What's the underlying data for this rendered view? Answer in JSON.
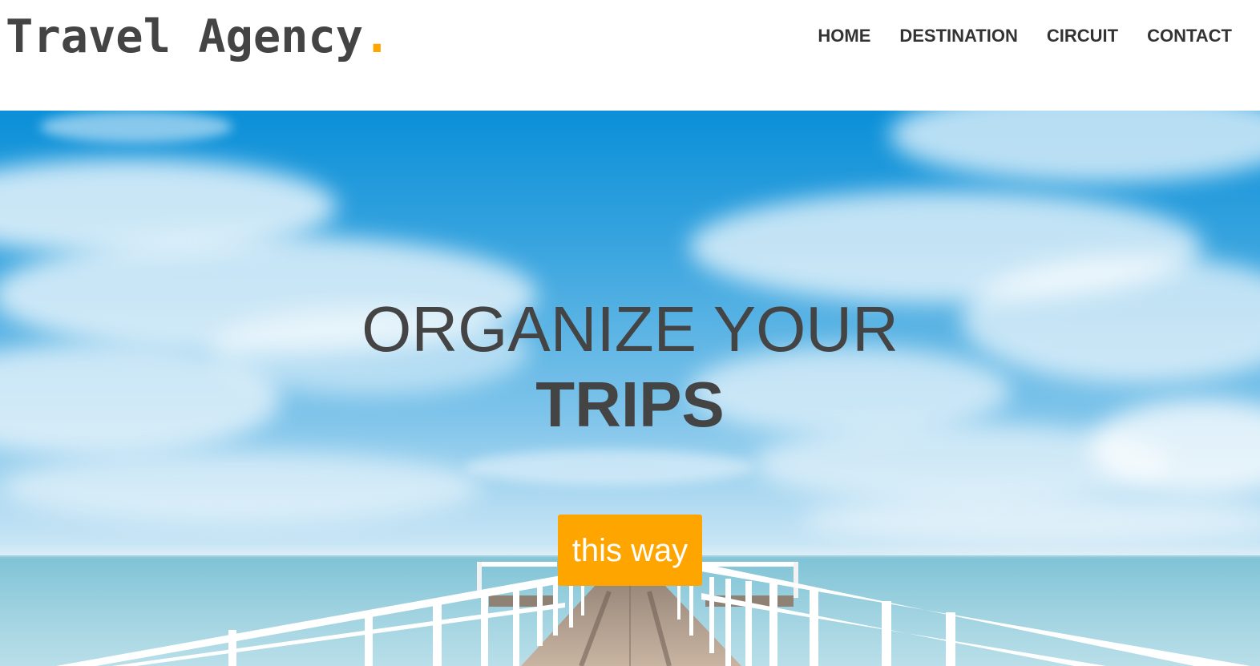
{
  "brand": {
    "name": "Travel Agency",
    "dot": ".",
    "accent_color": "#ffa500",
    "text_color": "#444444"
  },
  "nav": {
    "items": [
      {
        "label": "HOME"
      },
      {
        "label": "DESTINATION"
      },
      {
        "label": "CIRCUIT"
      },
      {
        "label": "CONTACT"
      }
    ]
  },
  "hero": {
    "headline_line1": "ORGANIZE YOUR",
    "headline_line2": "TRIPS",
    "cta_label": "this way",
    "background_scene": "sky-sea-pier"
  }
}
